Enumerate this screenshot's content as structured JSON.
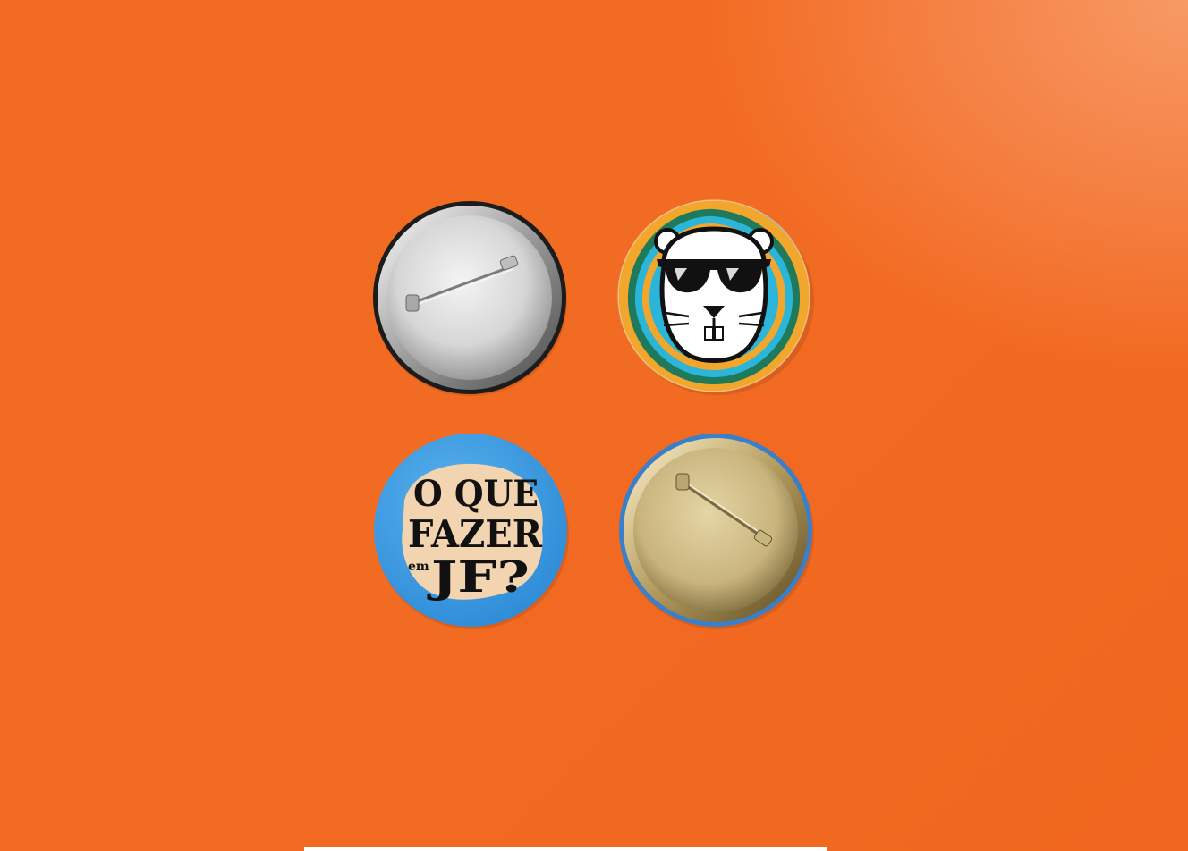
{
  "scene": {
    "background_color": "#f26b22",
    "highlight_color": "#f79a64"
  },
  "badges": [
    {
      "kind": "back",
      "finish": "silver",
      "rim": "#1a1a1a",
      "plate": "#d8d8d8"
    },
    {
      "kind": "front",
      "artwork": "beaver-with-sunglasses",
      "colors": [
        "#2bb5d8",
        "#f2a62b",
        "#1f7a5c",
        "#ffffff",
        "#000000"
      ]
    },
    {
      "kind": "front",
      "artwork": "lettering",
      "background": "#3a9ae0",
      "lettering": {
        "line1": "O QUE",
        "line2": "FAZER",
        "small": "em",
        "line3": "JF?"
      }
    },
    {
      "kind": "back",
      "finish": "gold",
      "rim": "#3a7fc9",
      "plate": "#cdbb8a"
    }
  ]
}
